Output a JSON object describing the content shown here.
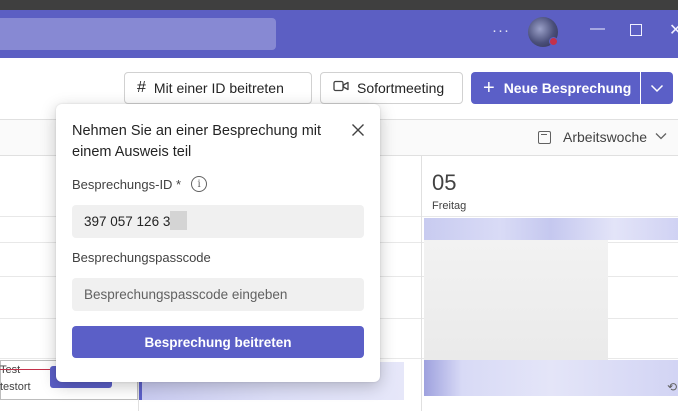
{
  "toolbar": {
    "join_by_id_label": "Mit einer ID beitreten",
    "meet_now_label": "Sofortmeeting",
    "new_meeting_label": "Neue Besprechung"
  },
  "calendar": {
    "view_label": "Arbeitswoche",
    "day": {
      "number": "05",
      "name": "Freitag"
    },
    "event": {
      "title": "Test",
      "location": "testort"
    }
  },
  "dialog": {
    "title": "Nehmen Sie an einer Besprechung mit einem Ausweis teil",
    "id_label": "Besprechungs-ID *",
    "id_value": "397 057 126 3",
    "passcode_label": "Besprechungspasscode",
    "passcode_placeholder": "Besprechungspasscode eingeben",
    "join_button": "Besprechung beitreten"
  },
  "colors": {
    "brand": "#5b5fc7",
    "titlebar": "#5c5fc3",
    "presence_busy": "#c4314b"
  },
  "icons": [
    "hash-icon",
    "video-camera-icon",
    "plus-icon",
    "chevron-down-icon",
    "calendar-icon",
    "close-icon",
    "info-icon",
    "more-icon",
    "minimize-icon",
    "maximize-icon",
    "sync-icon"
  ]
}
